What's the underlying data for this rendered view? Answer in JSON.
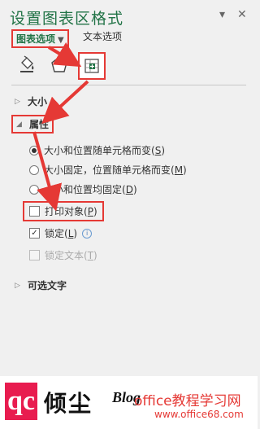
{
  "pane": {
    "title": "设置图表区格式",
    "collapse_glyph": "▾",
    "close_glyph": "✕"
  },
  "tabs": {
    "chart_options": "图表选项",
    "chart_options_arrow": "▼",
    "text_options": "文本选项"
  },
  "icons": {
    "fill_line": "paint-bucket-icon",
    "effects": "pentagon-icon",
    "size_properties": "size-properties-icon"
  },
  "sections": {
    "size": {
      "label": "大小",
      "expanded": false
    },
    "properties": {
      "label": "属性",
      "expanded": true
    },
    "alt_text": {
      "label": "可选文字",
      "expanded": false
    }
  },
  "properties": {
    "radio_options": [
      {
        "label": "大小和位置随单元格而变(",
        "key": "S",
        "tail": ")",
        "selected": true
      },
      {
        "label": "大小固定，位置随单元格而变(",
        "key": "M",
        "tail": ")",
        "selected": false
      },
      {
        "label": "大小和位置均固定(",
        "key": "D",
        "tail": ")",
        "selected": false
      }
    ],
    "print_object": {
      "label": "打印对象(",
      "key": "P",
      "tail": ")",
      "checked": false
    },
    "locked": {
      "label": "锁定(",
      "key": "L",
      "tail": ")",
      "checked": true,
      "info": "i"
    },
    "lock_text": {
      "label": "锁定文本(",
      "key": "T",
      "tail": ")",
      "checked": false,
      "disabled": true
    }
  },
  "footer": {
    "logo_letters": "qc",
    "brand_cn": "倾尘",
    "brand_en": "Blog",
    "site_name": "office教程学习网",
    "site_url": "www.office68.com"
  },
  "colors": {
    "accent_green": "#217346",
    "annotation_red": "#e53935"
  }
}
